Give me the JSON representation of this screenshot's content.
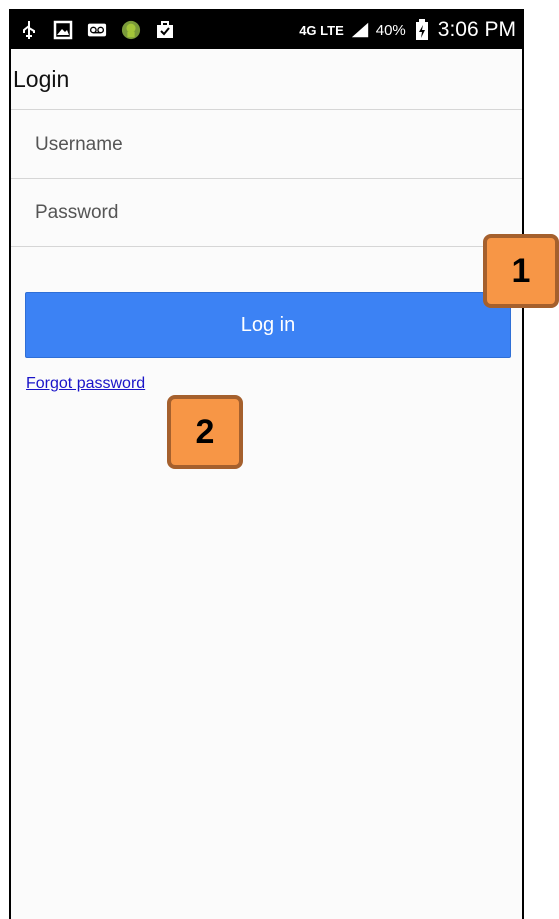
{
  "statusbar": {
    "icons_left": [
      "usb-icon",
      "image-icon",
      "voicemail-icon",
      "android-icon",
      "briefcase-icon"
    ],
    "network": "4G LTE",
    "battery_pct": "40%",
    "time": "3:06 PM"
  },
  "header": {
    "title": "Login"
  },
  "form": {
    "username_placeholder": "Username",
    "password_placeholder": "Password",
    "login_label": "Log in",
    "forgot_label": "Forgot password"
  },
  "annotations": {
    "badge1": "1",
    "badge2": "2"
  },
  "colors": {
    "primary": "#3c82f4",
    "link": "#1a14c8",
    "badge": "#f79646",
    "badge_border": "#a5602d"
  }
}
